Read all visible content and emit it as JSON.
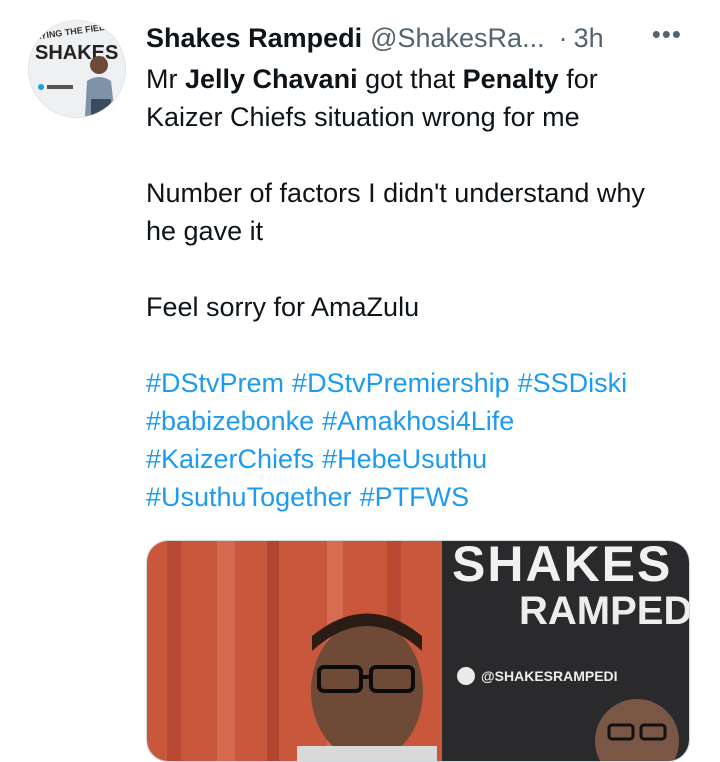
{
  "tweet": {
    "author_name": "Shakes Rampedi",
    "handle": "@ShakesRa...",
    "time_sep": "·",
    "time": "3h",
    "more": "•••",
    "avatar": {
      "banner_text": "AYING THE FIELD",
      "big_text": "SHAKES"
    },
    "lines": {
      "l1_prefix": "Mr ",
      "l1_name": "Jelly Chavani",
      "l1_mid": " got that ",
      "l1_word": "Penalty",
      "l1_suffix": " for",
      "l2": "Kaizer Chiefs situation wrong for me",
      "p2_l1": "Number of factors I didn't understand why",
      "p2_l2": "he gave it",
      "p3": "Feel sorry for AmaZulu"
    },
    "hashtags": {
      "row1": [
        "#DStvPrem",
        "#DStvPremiership",
        "#SSDiski"
      ],
      "row2": [
        "#babizebonke",
        "#Amakhosi4Life"
      ],
      "row3": [
        "#KaizerChiefs",
        "#HebeUsuthu"
      ],
      "row4": [
        "#UsuthuTogether",
        "#PTFWS"
      ]
    },
    "media": {
      "top_text": "SHAKES",
      "name_text": "RAMPEDI",
      "handle_text": "@SHAKESRAMPEDI"
    }
  },
  "colors": {
    "link": "#1d9bf0",
    "text": "#0f1419",
    "muted": "#536471"
  }
}
